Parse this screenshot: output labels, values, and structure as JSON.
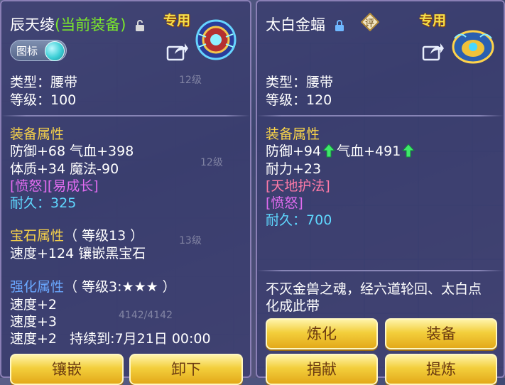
{
  "left": {
    "name": "辰天绫",
    "status": "(当前装备)",
    "zhuanyong": "专用",
    "toggle_label": "图标",
    "type": "类型：腰带",
    "level": "等级：100",
    "equip_header": "装备属性",
    "attr1": "防御+68 气血+398",
    "attr2": "体质+34 魔法-90",
    "tags": "[愤怒][易成长]",
    "durability_label": "耐久：",
    "durability_value": "325",
    "gem_header": "宝石属性",
    "gem_level": "（ 等级13 ）",
    "gem_attr": "速度+124 镶嵌黑宝石",
    "enhance_header": "强化属性",
    "enhance_level": "（ 等级3:★★★ ）",
    "enh1": "速度+2",
    "enh2": "速度+3",
    "enh3": "速度+2",
    "duration": "持续到:7月21日 00:00",
    "btn_inlay": "镶嵌",
    "btn_unequip": "卸下",
    "bg_text1": "12级",
    "bg_text2": "12级",
    "bg_text3": "13级",
    "bg_text4": "4142/4142"
  },
  "right": {
    "name": "太白金蝠",
    "zhuanyong": "专用",
    "rate_badge": "评",
    "type": "类型：腰带",
    "level": "等级：120",
    "equip_header": "装备属性",
    "attr1a": "防御+94",
    "attr1b": "气血+491",
    "attr2": "耐力+23",
    "tag1": "[天地护法]",
    "tag2": "[愤怒]",
    "durability_label": "耐久：",
    "durability_value": "700",
    "desc_line1": "不灭金兽之魂，经六道轮回、太白点",
    "desc_line2": "化成此带",
    "btn_refine": "炼化",
    "btn_equip": "装备",
    "btn_donate": "捐献",
    "btn_extract": "提炼"
  },
  "colors": {
    "gold": "#f7d24a",
    "green": "#7bea2a",
    "purple": "#e16cf0",
    "cyan": "#5fd8ff",
    "button": "#f3cf3c"
  }
}
